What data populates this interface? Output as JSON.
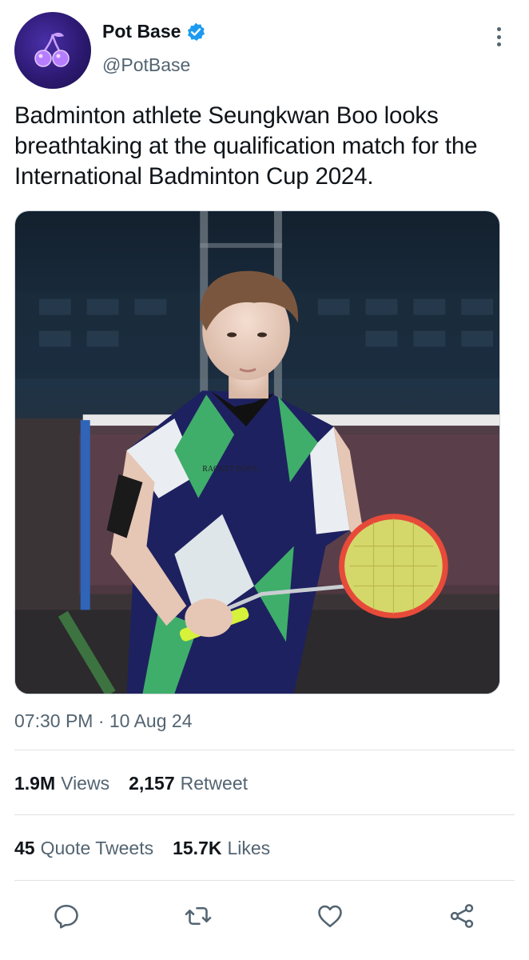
{
  "account": {
    "display_name": "Pot Base",
    "handle": "@PotBase",
    "verified": true
  },
  "tweet": {
    "text": "Badminton athlete Seungkwan Boo looks breathtaking at the qualification match for the International Badminton Cup 2024.",
    "jersey_text": "RACKET BOYS.",
    "timestamp": "07:30 PM · 10 Aug 24"
  },
  "stats": {
    "views_count": "1.9M",
    "views_label": "Views",
    "retweets_count": "2,157",
    "retweets_label": "Retweet",
    "quotes_count": "45",
    "quotes_label": "Quote Tweets",
    "likes_count": "15.7K",
    "likes_label": "Likes"
  },
  "actions": [
    "reply-icon",
    "retweet-icon",
    "like-icon",
    "share-icon"
  ],
  "colors": {
    "text": "#0f1419",
    "secondary": "#536471",
    "verified": "#1d9bf0",
    "divider": "#dfe3e6",
    "avatar": "#2d1a73"
  }
}
